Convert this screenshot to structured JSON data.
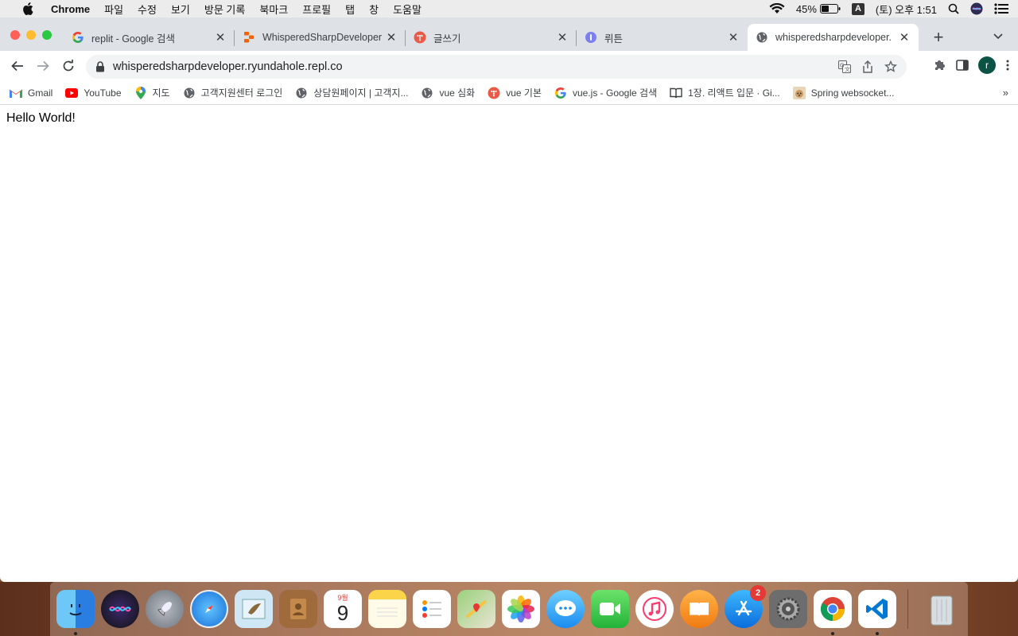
{
  "menubar": {
    "app_name": "Chrome",
    "items": [
      "파일",
      "수정",
      "보기",
      "방문 기록",
      "북마크",
      "프로필",
      "탭",
      "창",
      "도움말"
    ],
    "battery": "45%",
    "input_source": "A",
    "clock": "(토) 오후 1:51"
  },
  "tabs": [
    {
      "title": "replit - Google 검색",
      "icon": "google-icon"
    },
    {
      "title": "WhisperedSharpDeveloper",
      "icon": "replit-icon"
    },
    {
      "title": "글쓰기",
      "icon": "tistory-icon"
    },
    {
      "title": "뤼튼",
      "icon": "wrtn-icon"
    },
    {
      "title": "whisperedsharpdeveloper.",
      "icon": "globe-icon",
      "active": true
    }
  ],
  "toolbar": {
    "url": "whisperedsharpdeveloper.ryundahole.repl.co",
    "profile_initial": "r"
  },
  "bookmarks": [
    {
      "label": "Gmail",
      "icon": "gmail-icon"
    },
    {
      "label": "YouTube",
      "icon": "youtube-icon"
    },
    {
      "label": "지도",
      "icon": "maps-icon"
    },
    {
      "label": "고객지원센터 로그인",
      "icon": "globe-icon"
    },
    {
      "label": "상담원페이지 | 고객지...",
      "icon": "globe-icon"
    },
    {
      "label": "vue 심화",
      "icon": "globe-icon"
    },
    {
      "label": "vue 기본",
      "icon": "tistory-icon"
    },
    {
      "label": "vue.js - Google 검색",
      "icon": "google-icon"
    },
    {
      "label": "1장. 리액트 입문 · Gi...",
      "icon": "book-icon"
    },
    {
      "label": "Spring websocket...",
      "icon": "dog-icon"
    }
  ],
  "page": {
    "text": "Hello World!"
  },
  "dock": {
    "calendar_month": "9월",
    "calendar_day": "9",
    "appstore_badge": "2"
  },
  "colors": {
    "tabstrip": "#dee1e6",
    "omnibox": "#f1f3f4",
    "profile": "#0b5345"
  }
}
